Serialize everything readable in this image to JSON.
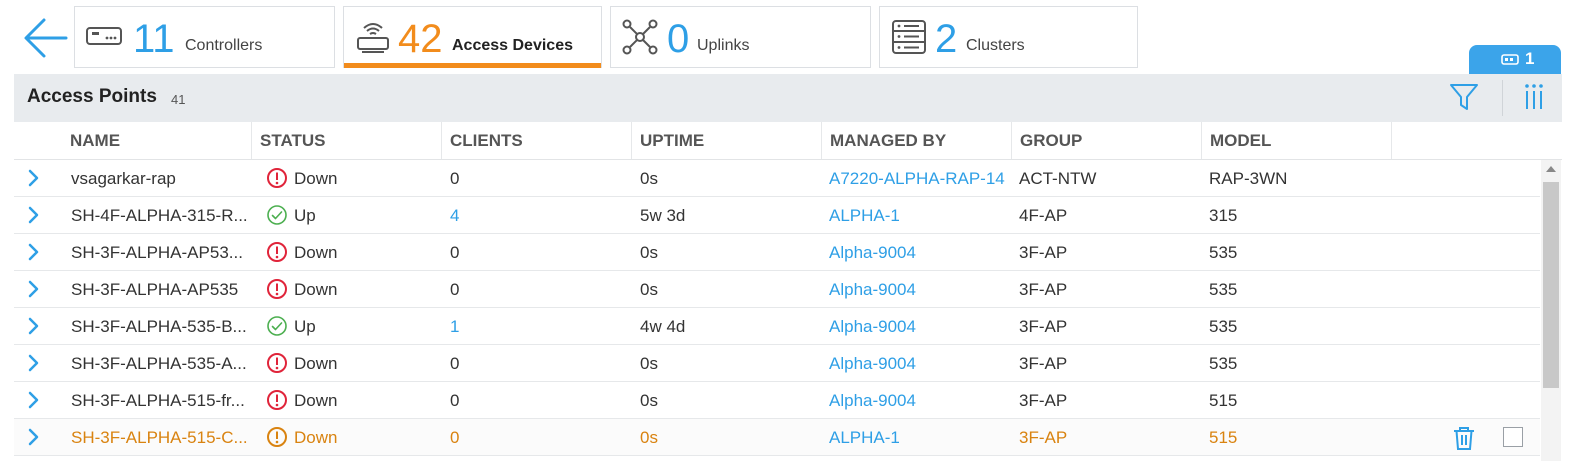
{
  "tiles": [
    {
      "count": "11",
      "label": "Controllers",
      "icon": "controller-icon"
    },
    {
      "count": "42",
      "label": "Access Devices",
      "icon": "access-device-icon",
      "active": true
    },
    {
      "count": "0",
      "label": "Uplinks",
      "icon": "uplinks-icon"
    },
    {
      "count": "2",
      "label": "Clusters",
      "icon": "clusters-icon"
    }
  ],
  "badge": {
    "count": "1",
    "icon": "device-icon"
  },
  "panel": {
    "title": "Access Points",
    "count": "41"
  },
  "columns": [
    "NAME",
    "STATUS",
    "CLIENTS",
    "UPTIME",
    "MANAGED BY",
    "GROUP",
    "MODEL"
  ],
  "rows": [
    {
      "name": "vsagarkar-rap",
      "status": "Down",
      "clients": "0",
      "uptime": "0s",
      "managed_by": "A7220-ALPHA-RAP-14",
      "group": "ACT-NTW",
      "model": "RAP-3WN"
    },
    {
      "name": "SH-4F-ALPHA-315-R...",
      "status": "Up",
      "clients": "4",
      "uptime": "5w 3d",
      "managed_by": "ALPHA-1",
      "group": "4F-AP",
      "model": "315"
    },
    {
      "name": "SH-3F-ALPHA-AP53...",
      "status": "Down",
      "clients": "0",
      "uptime": "0s",
      "managed_by": "Alpha-9004",
      "group": "3F-AP",
      "model": "535"
    },
    {
      "name": "SH-3F-ALPHA-AP535",
      "status": "Down",
      "clients": "0",
      "uptime": "0s",
      "managed_by": "Alpha-9004",
      "group": "3F-AP",
      "model": "535"
    },
    {
      "name": "SH-3F-ALPHA-535-B...",
      "status": "Up",
      "clients": "1",
      "uptime": "4w 4d",
      "managed_by": "Alpha-9004",
      "group": "3F-AP",
      "model": "535"
    },
    {
      "name": "SH-3F-ALPHA-535-A...",
      "status": "Down",
      "clients": "0",
      "uptime": "0s",
      "managed_by": "Alpha-9004",
      "group": "3F-AP",
      "model": "535"
    },
    {
      "name": "SH-3F-ALPHA-515-fr...",
      "status": "Down",
      "clients": "0",
      "uptime": "0s",
      "managed_by": "Alpha-9004",
      "group": "3F-AP",
      "model": "515"
    },
    {
      "name": "SH-3F-ALPHA-515-C...",
      "status": "Down",
      "clients": "0",
      "uptime": "0s",
      "managed_by": "ALPHA-1",
      "group": "3F-AP",
      "model": "515",
      "warning": true
    }
  ],
  "colors": {
    "accent": "#2e9fe6",
    "active": "#f28c1c",
    "down": "#e0243a",
    "up": "#4caf50",
    "warning": "#d98310"
  }
}
